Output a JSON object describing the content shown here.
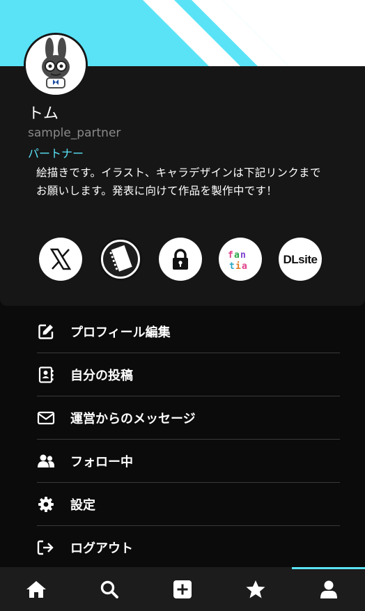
{
  "profile": {
    "name": "トム",
    "handle": "sample_partner",
    "role": "パートナー",
    "bio": "絵描きです。イラスト、キャラデザインは下記リンクまでお願いします。発表に向けて作品を製作中です！"
  },
  "social_links": [
    {
      "icon": "x-icon"
    },
    {
      "icon": "notebook-icon"
    },
    {
      "icon": "lock-icon"
    },
    {
      "icon": "fantia-icon",
      "text": "fantia"
    },
    {
      "icon": "dlsite-icon",
      "text": "DLsite"
    }
  ],
  "menu": {
    "items": [
      {
        "label": "プロフィール編集",
        "icon": "edit-icon"
      },
      {
        "label": "自分の投稿",
        "icon": "contact-book-icon"
      },
      {
        "label": "運営からのメッセージ",
        "icon": "envelope-icon"
      },
      {
        "label": "フォロー中",
        "icon": "users-icon"
      },
      {
        "label": "設定",
        "icon": "gear-icon"
      },
      {
        "label": "ログアウト",
        "icon": "logout-icon"
      }
    ]
  },
  "bottom_nav": {
    "items": [
      {
        "icon": "home-icon"
      },
      {
        "icon": "search-icon"
      },
      {
        "icon": "plus-square-icon"
      },
      {
        "icon": "star-icon"
      },
      {
        "icon": "user-icon",
        "active": true
      }
    ]
  },
  "colors": {
    "accent": "#5ae3f7",
    "card": "#161616",
    "background": "#0b0b0b",
    "nav": "#1c1c1c"
  }
}
